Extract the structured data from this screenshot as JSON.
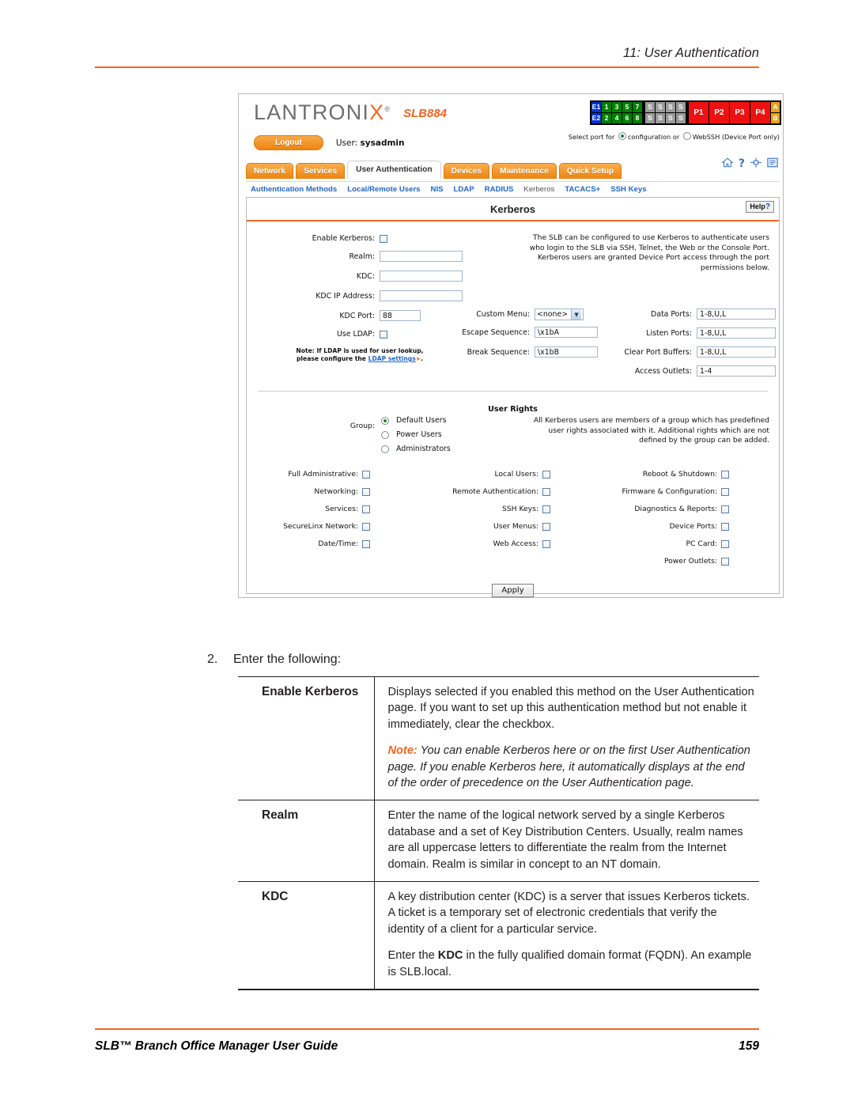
{
  "page": {
    "chapter_header": "11: User Authentication",
    "footer_left": "SLB™ Branch Office Manager User Guide",
    "footer_page": "159",
    "accent_color": "#f26522"
  },
  "app": {
    "logo_text": "LANTRONI",
    "logo_x": "X",
    "logo_reg": "®",
    "model": "SLB884",
    "logout_label": "Logout",
    "user_prefix": "User:",
    "user_name": "sysadmin",
    "portmap": {
      "eth": [
        "E1",
        "E2"
      ],
      "device_top": [
        "1",
        "3",
        "5",
        "7"
      ],
      "device_bottom": [
        "2",
        "4",
        "6",
        "8"
      ],
      "serial_top": [
        "S",
        "S",
        "S",
        "S"
      ],
      "serial_bottom": [
        "S",
        "S",
        "S",
        "S"
      ],
      "power": [
        "P1",
        "P2",
        "P3",
        "P4"
      ],
      "outlets": [
        "A",
        "B"
      ]
    },
    "select_port_prefix": "Select port for",
    "select_port_opt1": "configuration",
    "select_port_or": "or",
    "select_port_opt2": "WebSSH (Device Port only)",
    "tabs": [
      {
        "label": "Network",
        "active": false
      },
      {
        "label": "Services",
        "active": false
      },
      {
        "label": "User Authentication",
        "active": true
      },
      {
        "label": "Devices",
        "active": false
      },
      {
        "label": "Maintenance",
        "active": false
      },
      {
        "label": "Quick Setup",
        "active": false
      }
    ],
    "tool_icons": [
      "home-icon",
      "help-icon",
      "sitemap-icon",
      "logs-icon"
    ],
    "subnav": [
      {
        "label": "Authentication Methods",
        "current": false
      },
      {
        "label": "Local/Remote Users",
        "current": false
      },
      {
        "label": "NIS",
        "current": false
      },
      {
        "label": "LDAP",
        "current": false
      },
      {
        "label": "RADIUS",
        "current": false
      },
      {
        "label": "Kerberos",
        "current": true
      },
      {
        "label": "TACACS+",
        "current": false
      },
      {
        "label": "SSH Keys",
        "current": false
      }
    ],
    "panel_title": "Kerberos",
    "help_label": "Help",
    "help_q": "?",
    "form": {
      "enable_kerberos_label": "Enable Kerberos:",
      "realm_label": "Realm:",
      "realm_value": "",
      "kdc_label": "KDC:",
      "kdc_value": "",
      "kdc_ip_label": "KDC IP Address:",
      "kdc_ip_value": "",
      "kdc_port_label": "KDC Port:",
      "kdc_port_value": "88",
      "use_ldap_label": "Use LDAP:",
      "ldap_note_line1": "Note: If LDAP is used for user lookup,",
      "ldap_note_line2_pre": "please configure the",
      "ldap_note_link": "LDAP settings",
      "ldap_note_arrow": "➤",
      "ldap_note_end": ".",
      "custom_menu_label": "Custom Menu:",
      "custom_menu_value": "<none>",
      "escape_seq_label": "Escape Sequence:",
      "escape_seq_value": "\\x1bA",
      "break_seq_label": "Break Sequence:",
      "break_seq_value": "\\x1bB",
      "data_ports_label": "Data Ports:",
      "data_ports_value": "1-8,U,L",
      "listen_ports_label": "Listen Ports:",
      "listen_ports_value": "1-8,U,L",
      "clear_buffers_label": "Clear Port Buffers:",
      "clear_buffers_value": "1-8,U,L",
      "access_outlets_label": "Access Outlets:",
      "access_outlets_value": "1-4",
      "info_text": "The SLB can be configured to use Kerberos to authenticate users who login to the SLB via SSH, Telnet, the Web or the Console Port. Kerberos users are granted Device Port access through the port permissions below."
    },
    "user_rights": {
      "title": "User Rights",
      "group_label": "Group:",
      "groups": [
        {
          "label": "Default Users",
          "selected": true
        },
        {
          "label": "Power Users",
          "selected": false
        },
        {
          "label": "Administrators",
          "selected": false
        }
      ],
      "info_text": "All Kerberos users are members of a group which has predefined user rights associated with it. Additional rights which are not defined by the group can be added.",
      "col1": [
        {
          "label": "Full Administrative:",
          "checked": false
        },
        {
          "label": "Networking:",
          "checked": false
        },
        {
          "label": "Services:",
          "checked": false
        },
        {
          "label": "SecureLinx Network:",
          "checked": false
        },
        {
          "label": "Date/Time:",
          "checked": false
        }
      ],
      "col2": [
        {
          "label": "Local Users:",
          "checked": false
        },
        {
          "label": "Remote Authentication:",
          "checked": false
        },
        {
          "label": "SSH Keys:",
          "checked": false
        },
        {
          "label": "User Menus:",
          "checked": false
        },
        {
          "label": "Web Access:",
          "checked": false
        }
      ],
      "col3": [
        {
          "label": "Reboot & Shutdown:",
          "checked": false
        },
        {
          "label": "Firmware & Configuration:",
          "checked": false
        },
        {
          "label": "Diagnostics & Reports:",
          "checked": false
        },
        {
          "label": "Device Ports:",
          "checked": false
        },
        {
          "label": "PC Card:",
          "checked": false
        },
        {
          "label": "Power Outlets:",
          "checked": false
        }
      ]
    },
    "apply_label": "Apply"
  },
  "doc": {
    "step_number": "2.",
    "step_text": "Enter the following:",
    "definitions": [
      {
        "term": "Enable Kerberos",
        "paragraphs": [
          {
            "style": "normal",
            "text": "Displays selected if you enabled this method on the User Authentication page. If you want to set up this authentication method but not enable it immediately, clear the checkbox."
          },
          {
            "style": "note",
            "note_label": "Note:",
            "text": " You can enable Kerberos here or on the first User Authentication page. If you enable Kerberos here, it automatically displays at the end of the order of precedence on the User Authentication page."
          }
        ]
      },
      {
        "term": "Realm",
        "paragraphs": [
          {
            "style": "normal",
            "text": "Enter the name of the logical network served by a single Kerberos database and a set of Key Distribution Centers. Usually, realm names are all uppercase letters to differentiate the realm from the Internet domain. Realm is similar in concept to an NT domain."
          }
        ]
      },
      {
        "term": "KDC",
        "paragraphs": [
          {
            "style": "normal",
            "text": "A key distribution center (KDC) is a server that issues Kerberos tickets. A ticket is a temporary set of electronic credentials that verify the identity of a client for a particular service."
          },
          {
            "style": "bold-inline",
            "pre": "Enter the ",
            "bold": "KDC",
            "post": " in the fully qualified domain format (FQDN). An example is SLB.local."
          }
        ]
      }
    ]
  }
}
